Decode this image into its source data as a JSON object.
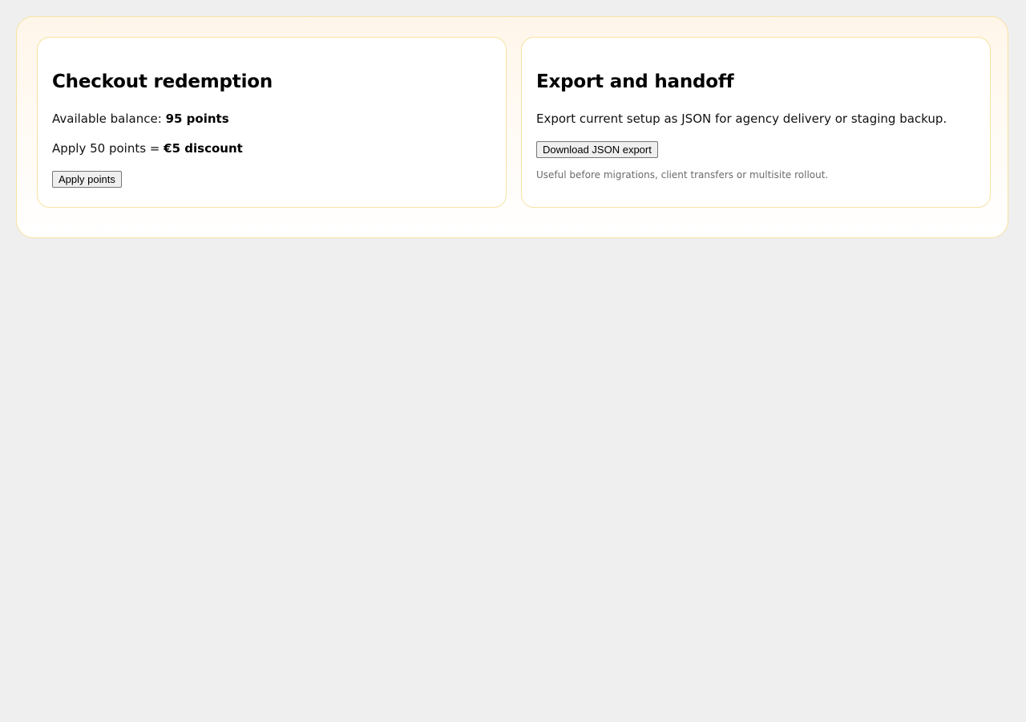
{
  "redemption": {
    "title": "Checkout redemption",
    "balance_label": "Available balance:",
    "balance_value": "95 points",
    "apply_prefix": "Apply 50 points =",
    "apply_value": "€5 discount",
    "apply_button": "Apply points"
  },
  "export": {
    "title": "Export and handoff",
    "description": "Export current setup as JSON for agency delivery or staging backup.",
    "download_button": "Download JSON export",
    "hint": "Useful before migrations, client transfers or multisite rollout."
  }
}
